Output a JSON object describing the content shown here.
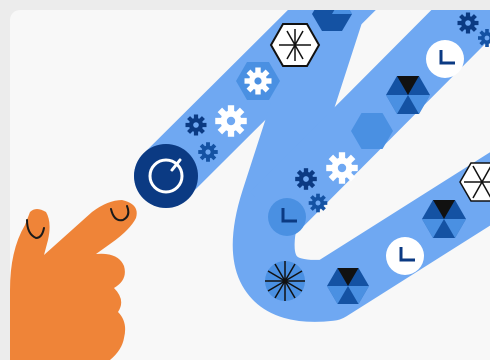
{
  "illustration": {
    "alt": "",
    "colors": {
      "background": "#f8f8f8",
      "frame": "#ececec",
      "track": "#6fa8f2",
      "light_blue": "#4a90e2",
      "dark_blue": "#1452a3",
      "navy": "#0b3a83",
      "white": "#ffffff",
      "black": "#111111",
      "hand": "#ef8438",
      "hand_outline": "#1a1a1a"
    },
    "icons": [
      "power-button-icon",
      "gear-icon",
      "clock-icon",
      "hexagon-icon",
      "wheel-icon",
      "pinwheel-icon",
      "pointing-hand-icon"
    ]
  }
}
